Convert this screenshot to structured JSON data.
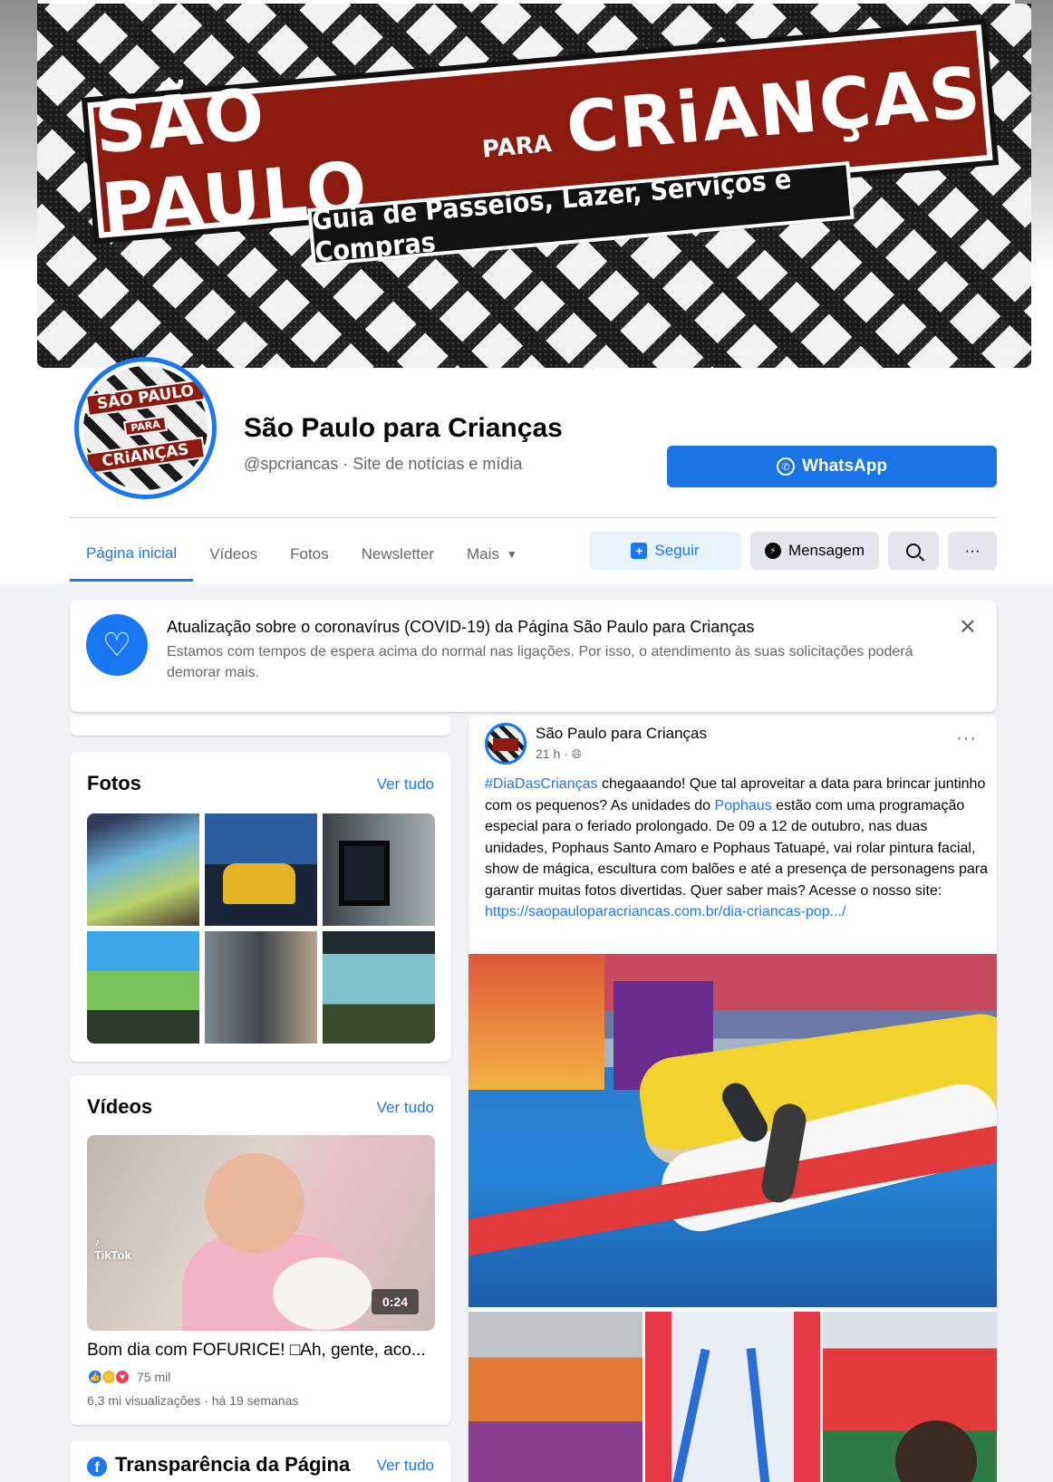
{
  "cover": {
    "banner_main_1": "SÃO PAULO",
    "banner_para": "PARA",
    "banner_main_2": "CRiANÇAS",
    "banner_subtitle": "Guia de Passeios, Lazer, Serviços e Compras"
  },
  "profile": {
    "avatar_line1": "SÃO PAULO",
    "avatar_line2": "PARA",
    "avatar_line3": "CRiANÇAS",
    "name": "São Paulo para Crianças",
    "handle": "@spcriancas · Site de notícias e mídia",
    "whatsapp_label": "WhatsApp"
  },
  "tabs": [
    {
      "label": "Página inicial",
      "active": true
    },
    {
      "label": "Vídeos"
    },
    {
      "label": "Fotos"
    },
    {
      "label": "Newsletter"
    },
    {
      "label": "Mais"
    }
  ],
  "actions": {
    "follow": "Seguir",
    "message": "Mensagem",
    "more": "···"
  },
  "covid": {
    "title": "Atualização sobre o coronavírus (COVID-19) da Página São Paulo para Crianças",
    "body": "Estamos com tempos de espera acima do normal nas ligações. Por isso, o atendimento às suas solicitações poderá demorar mais.",
    "close": "✕"
  },
  "photos": {
    "title": "Fotos",
    "see_all": "Ver tudo"
  },
  "videos": {
    "title": "Vídeos",
    "see_all": "Ver tudo",
    "tiktok_label": "TikTok",
    "duration": "0:24",
    "video_title": "Bom dia com FOFURICE! □Ah, gente, aco...",
    "reaction_count": "75 mil",
    "meta": "6,3 mi visualizações · há 19 semanas"
  },
  "transparency": {
    "title": "Transparência da Página",
    "see_all": "Ver tudo"
  },
  "post": {
    "author": "São Paulo para Crianças",
    "time": "21 h · ",
    "more": "···",
    "hashtag": "#DiaDasCrianças",
    "text_1": " chegaaando! Que tal aproveitar a data para brincar juntinho com os pequenos? As unidades do ",
    "mention": "Pophaus",
    "text_2": " estão com uma programação especial para o feriado prolongado. De 09 a 12 de outubro, nas duas unidades, Pophaus Santo Amaro e Pophaus Tatuapé, vai rolar pintura facial, show de mágica, escultura com balões e até a presença de personagens para garantir muitas fotos divertidas. Quer saber mais? Acesse o nosso site:",
    "url": "https://saopauloparacriancas.com.br/dia-criancas-pop.../"
  },
  "colors": {
    "primary": "#1877f2",
    "background": "#f0f2f5",
    "brand_red": "#8c1a0e"
  }
}
